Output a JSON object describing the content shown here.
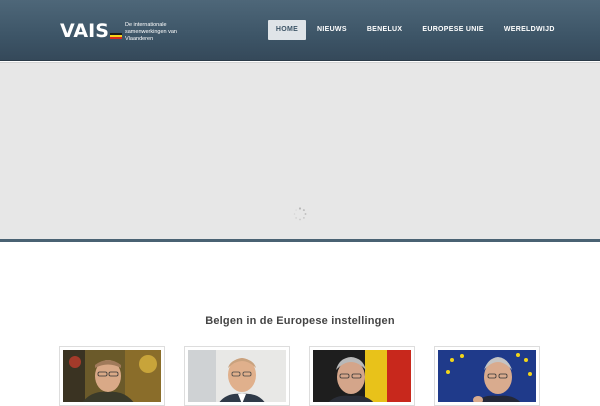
{
  "header": {
    "logo_text": "VAIS",
    "tagline_lines": [
      "De internationale",
      "samenwerkingen van",
      "Vlaanderen"
    ]
  },
  "nav": {
    "items": [
      "HOME",
      "NIEUWS",
      "BENELUX",
      "EUROPESE UNIE",
      "WERELDWIJD"
    ],
    "active": "HOME"
  },
  "slider": {
    "state": "loading",
    "spinner_icon": "loading-spinner-icon"
  },
  "section": {
    "title": "Belgen in de Europese instellingen"
  },
  "thumbnails": [
    {
      "icon": "portrait-photo-icon"
    },
    {
      "icon": "portrait-photo-icon"
    },
    {
      "icon": "portrait-photo-icon"
    },
    {
      "icon": "portrait-photo-icon"
    }
  ],
  "colors": {
    "header_bg": "#3d5567",
    "nav_active_bg": "#dfe4e8",
    "slider_bg": "#e7e7e7",
    "accent_line": "#4a6273",
    "flag_black": "#1a1a1a",
    "flag_yellow": "#f7d417",
    "flag_red": "#d52b1e"
  }
}
